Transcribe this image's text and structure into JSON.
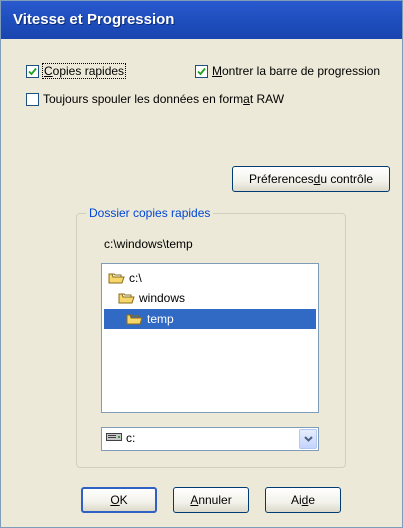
{
  "window": {
    "title": "Vitesse et Progression"
  },
  "options": {
    "fast_copies": {
      "label_u": "C",
      "label_rest": "opies rapides",
      "checked": true
    },
    "show_progress": {
      "label_u": "M",
      "label_rest": "ontrer la barre de progression",
      "checked": true
    },
    "raw_spool": {
      "label_pre": "Toujours spouler les données en form",
      "label_u": "a",
      "label_post": "t RAW",
      "checked": false
    }
  },
  "prefs_button": {
    "label_pre": "Préferences ",
    "label_u": "d",
    "label_post": "u contrôle"
  },
  "folder_group": {
    "title": "Dossier copies rapides",
    "current_path": "c:\\windows\\temp",
    "tree": [
      {
        "label": "c:\\",
        "state": "open"
      },
      {
        "label": "windows",
        "state": "open"
      },
      {
        "label": "temp",
        "state": "open",
        "selected": true
      }
    ],
    "drive": {
      "value": "c:",
      "icon": "drive-icon"
    }
  },
  "buttons": {
    "ok": {
      "label_u": "O",
      "label_rest": "K"
    },
    "cancel": {
      "label_u": "A",
      "label_rest": "nnuler"
    },
    "help": {
      "label_pre": "Ai",
      "label_u": "d",
      "label_post": "e"
    }
  },
  "colors": {
    "title_bar": "#1f4fbf",
    "dialog_bg": "#ece9d8",
    "selection": "#316ac5",
    "group_title": "#0046d5"
  }
}
